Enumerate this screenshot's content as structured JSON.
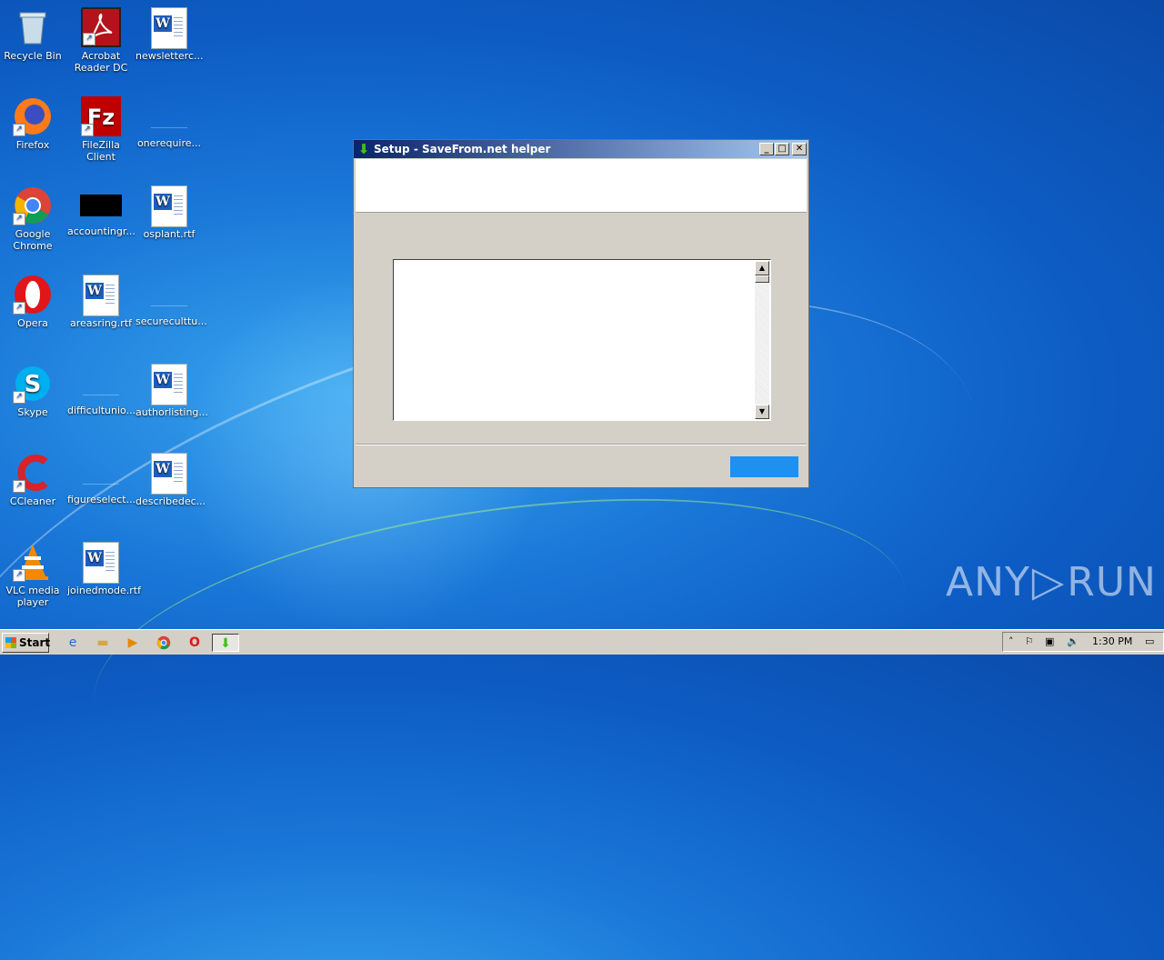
{
  "desktop": {
    "icons": [
      {
        "label": "Recycle Bin"
      },
      {
        "label": "Acrobat Reader DC"
      },
      {
        "label": "newsletterc..."
      },
      {
        "label": "Firefox"
      },
      {
        "label": "FileZilla Client"
      },
      {
        "label": "onerequire..."
      },
      {
        "label": "Google Chrome"
      },
      {
        "label": "accountingr..."
      },
      {
        "label": "osplant.rtf"
      },
      {
        "label": "Opera"
      },
      {
        "label": "areasring.rtf"
      },
      {
        "label": "secureculttu..."
      },
      {
        "label": "Skype"
      },
      {
        "label": "difficultunio..."
      },
      {
        "label": "authorlisting..."
      },
      {
        "label": "CCleaner"
      },
      {
        "label": "figureselect..."
      },
      {
        "label": "describedec..."
      },
      {
        "label": "VLC media player"
      },
      {
        "label": "joinedmode.rtf"
      }
    ]
  },
  "dialog": {
    "title": "Setup - SaveFrom.net helper"
  },
  "watermark": {
    "left": "ANY",
    "right": "RUN"
  },
  "taskbar": {
    "start_label": "Start",
    "clock": "1:30 PM"
  }
}
